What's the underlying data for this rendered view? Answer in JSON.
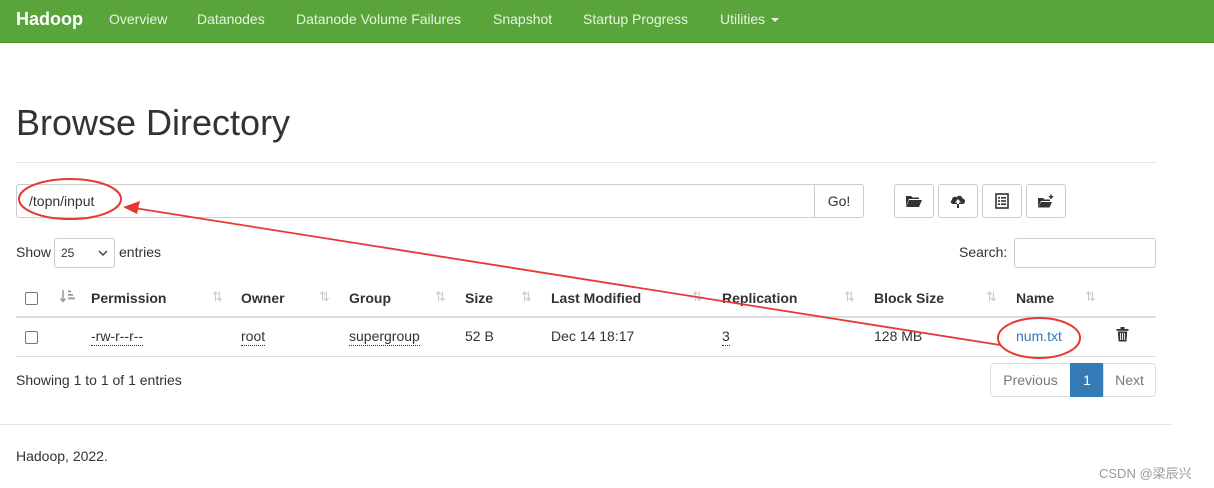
{
  "navbar": {
    "brand": "Hadoop",
    "items": [
      "Overview",
      "Datanodes",
      "Datanode Volume Failures",
      "Snapshot",
      "Startup Progress",
      "Utilities"
    ]
  },
  "page": {
    "title": "Browse Directory",
    "path_value": "/topn/input",
    "go_label": "Go!"
  },
  "toolbar_icons": [
    "folder-open-icon",
    "cloud-upload-icon",
    "list-alt-icon",
    "folder-plus-icon"
  ],
  "datatable": {
    "show_label": "Show",
    "page_length": "25",
    "entries_label": "entries",
    "search_label": "Search:",
    "columns": [
      "Permission",
      "Owner",
      "Group",
      "Size",
      "Last Modified",
      "Replication",
      "Block Size",
      "Name"
    ],
    "rows": [
      {
        "permission": "-rw-r--r--",
        "owner": "root",
        "group": "supergroup",
        "size": "52 B",
        "last_modified": "Dec 14 18:17",
        "replication": "3",
        "block_size": "128 MB",
        "name": "num.txt"
      }
    ],
    "info": "Showing 1 to 1 of 1 entries",
    "pagination": {
      "previous": "Previous",
      "current": "1",
      "next": "Next"
    }
  },
  "footer": {
    "text": "Hadoop, 2022."
  },
  "watermark": "CSDN @梁辰兴",
  "colors": {
    "navbar": "#5aa43c",
    "link": "#337ab7",
    "annotation": "#e53935"
  }
}
